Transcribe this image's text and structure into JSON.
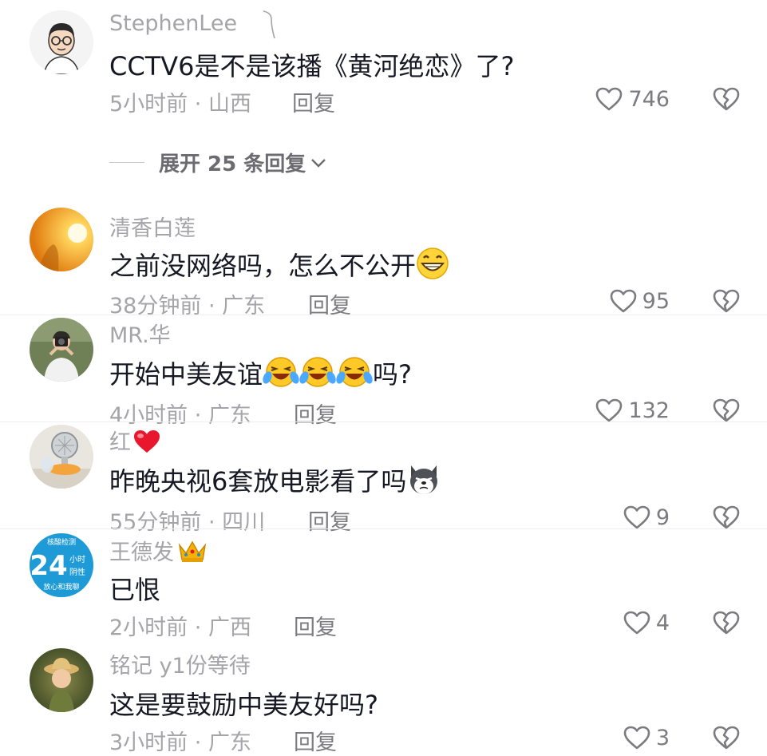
{
  "comments": [
    {
      "username": "StephenLee",
      "text": "CCTV6是不是该播《黄河绝恋》了?",
      "time": "5小时前",
      "location": "山西",
      "reply": "回复",
      "likes": "746"
    },
    {
      "username": "清香白莲",
      "text": "之前没网络吗，怎么不公开",
      "time": "38分钟前",
      "location": "广东",
      "reply": "回复",
      "likes": "95"
    },
    {
      "username": "MR.华",
      "text": "开始中美友谊",
      "text_suffix": "吗?",
      "time": "4小时前",
      "location": "广东",
      "reply": "回复",
      "likes": "132"
    },
    {
      "username": "红",
      "text": "昨晚央视6套放电影看了吗",
      "time": "55分钟前",
      "location": "四川",
      "reply": "回复",
      "likes": "9"
    },
    {
      "username": "王德发",
      "text": "已恨",
      "time": "2小时前",
      "location": "广西",
      "reply": "回复",
      "likes": "4"
    },
    {
      "username": "铭记 y1份等待",
      "text": "这是要鼓励中美友好吗?",
      "time": "3小时前",
      "location": "广东",
      "reply": "回复",
      "likes": "3"
    }
  ],
  "expand_replies": "展开 25 条回复",
  "avatar4_text": {
    "top": "核酸检测",
    "num": "24",
    "unit": "小时",
    "result": "阴性",
    "bottom": "放心和我聊"
  },
  "colors": {
    "text": "#161823",
    "muted": "#a4a4a9",
    "icon": "#7b7b80"
  }
}
